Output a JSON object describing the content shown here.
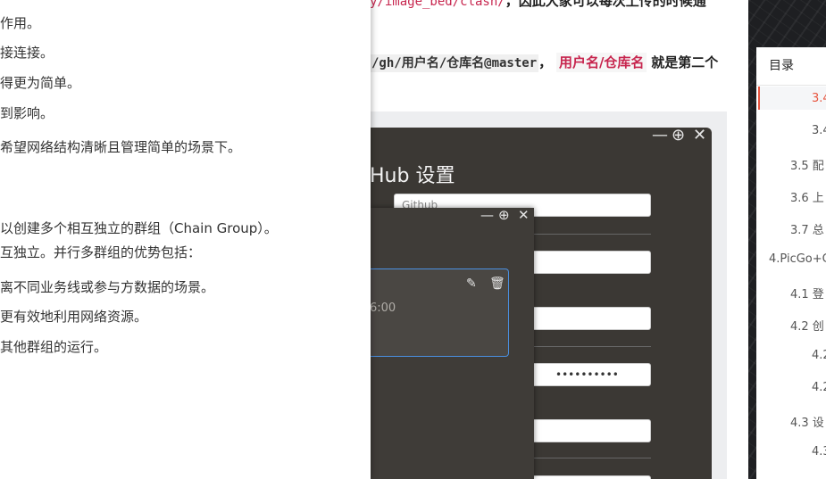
{
  "left_document": {
    "lines": [
      "作用。",
      "接连接。",
      "得更为简单。",
      "到影响。",
      "希望网络结构清晰且管理简单的场景下。",
      "以创建多个相互独立的群组（Chain Group）。",
      "互独立。并行多群组的优势包括：",
      "离不同业务线或参与方数据的场景。",
      "更有效地利用网络资源。",
      "其他群组的运行。"
    ]
  },
  "article": {
    "line1_code": "y/image_bed/clash/",
    "line1_text": "，因此大家可以每次上传的时候通",
    "line2_code": "/gh/用户名/仓库名@master",
    "line2_sep": "，",
    "line2_highlight": "用户名/仓库名",
    "line2_text": "就是第二个"
  },
  "settings_window": {
    "title": "Hub 设置",
    "minimize_icon": "—",
    "maximize_icon": "⊕",
    "close_icon": "✕",
    "fields": [
      {
        "value": "Github"
      },
      {
        "value": ""
      },
      {
        "value": ""
      },
      {
        "value": "••••••••••"
      },
      {
        "value": ""
      },
      {
        "value": ""
      }
    ]
  },
  "dialog": {
    "minimize_icon": "—",
    "maximize_icon": "⊕",
    "close_icon": "✕",
    "card_time": "6:00",
    "edit_icon": "✎",
    "delete_icon": "🗑"
  },
  "toc": {
    "header": "目录",
    "items": [
      "3.4",
      "3.4",
      "3.5 配",
      "3.6 上",
      "3.7 总",
      "4.PicGo+C",
      "4.1 登",
      "4.2 创",
      "4.2",
      "4.2",
      "4.3 设",
      "4.3"
    ],
    "active_color": "#e8553f"
  }
}
